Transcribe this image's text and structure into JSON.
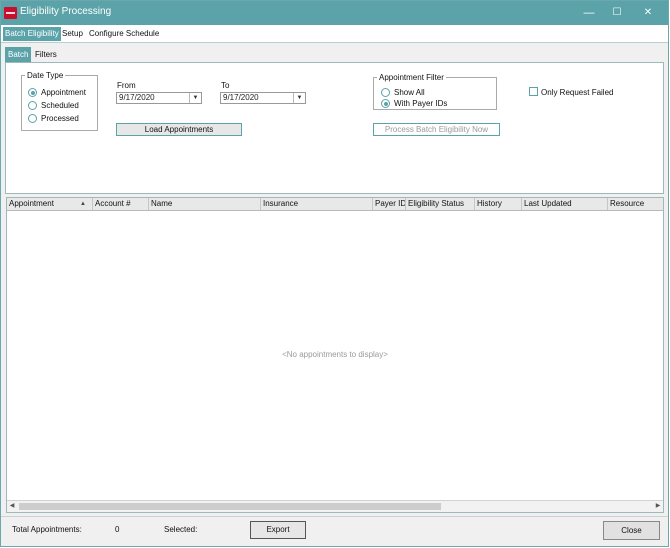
{
  "window": {
    "title": "Eligibility Processing",
    "minimize": "—",
    "maximize": "☐",
    "close": "✕"
  },
  "main_tabs": [
    {
      "label": "Batch Eligibility",
      "active": true
    },
    {
      "label": "Setup",
      "active": false
    },
    {
      "label": "Configure Schedule",
      "active": false
    }
  ],
  "sub_tabs": [
    {
      "label": "Batch",
      "active": true
    },
    {
      "label": "Filters",
      "active": false
    }
  ],
  "date_type": {
    "legend": "Date Type",
    "options": [
      {
        "label": "Appointment",
        "selected": true
      },
      {
        "label": "Scheduled",
        "selected": false
      },
      {
        "label": "Processed",
        "selected": false
      }
    ]
  },
  "from": {
    "label": "From",
    "value": "9/17/2020"
  },
  "to": {
    "label": "To",
    "value": "9/17/2020"
  },
  "load_button": "Load Appointments",
  "appointment_filter": {
    "legend": "Appointment Filter",
    "options": [
      {
        "label": "Show All",
        "selected": false
      },
      {
        "label": "With Payer IDs",
        "selected": true
      }
    ]
  },
  "process_button": "Process Batch Eligibility Now",
  "only_failed": {
    "label": "Only Request Failed",
    "checked": false
  },
  "grid": {
    "columns": [
      "Appointment",
      "Account #",
      "Name",
      "Insurance",
      "Payer ID",
      "Eligibility Status",
      "History",
      "Last Updated",
      "Resource"
    ],
    "sort_indicator": "▲",
    "empty_text": "<No appointments to display>"
  },
  "footer": {
    "total_label": "Total Appointments:",
    "total_value": "0",
    "selected_label": "Selected:",
    "export_button": "Export",
    "close_button": "Close"
  },
  "colors": {
    "accent": "#5ba3a8",
    "brand_icon": "#c8102e"
  }
}
